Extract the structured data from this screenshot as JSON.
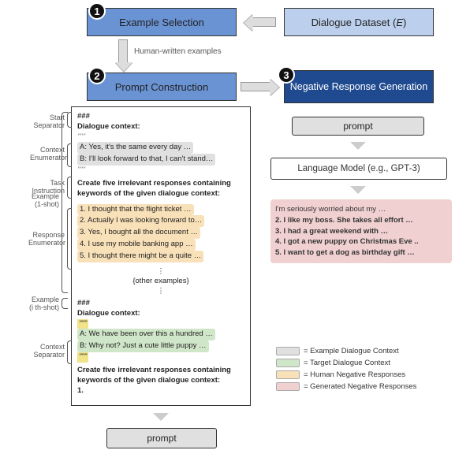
{
  "top": {
    "example_sel": "Example Selection",
    "dataset": "Dialogue Dataset (E)",
    "prompt_con": "Prompt Construction",
    "neg_gen": "Negative Response Generation",
    "hw_examples": "Human-written examples"
  },
  "numbers": {
    "n1": "1",
    "n2": "2",
    "n3": "3"
  },
  "labels": {
    "start_sep": "Start\nSeparator",
    "ctx_enum": "Context\nEnumerator",
    "task_inst": "Task\nInstruction",
    "resp_enum": "Response\nEnumerator",
    "ex_1shot": "Example\n(1-shot)",
    "ex_ishot": "Example\n(i th-shot)",
    "ctx_sep": "Context\nSeparator"
  },
  "prompt": {
    "sep1": "###",
    "dc_header": "Dialogue context:",
    "quote": "\"\"\"",
    "ctx_a": "A:  Yes, it's the same every day …",
    "ctx_b": "B:  I'll look forward to that, I can't stand…",
    "task": "Create five irrelevant responses containing keywords of the given dialogue context:",
    "r1": "1.  I thought that the flight ticket …",
    "r2": "2.  Actually I was looking forward to…",
    "r3": "3.  Yes, I bought all the document …",
    "r4": "4.  I use my mobile banking app …",
    "r5": "5.  I thought there might be a quite …",
    "other": "{other examples}",
    "vdots": "⋮",
    "sep2": "###",
    "tgt_a": "A:  We have been over this a hundred …",
    "tgt_b": "B:  Why not? Just a cute little puppy …",
    "final1": "1."
  },
  "bottom": {
    "prompt1": "prompt",
    "prompt2": "prompt",
    "lm": "Language Model (e.g., GPT-3)"
  },
  "gen": {
    "g1": "    I'm seriously worried about my …",
    "g2": "2. I like my boss. She takes all effort …",
    "g3": "3. I had a great weekend with …",
    "g4": "4. I got a new puppy on Christmas Eve ..",
    "g5": "5. I want to get a dog as birthday gift …"
  },
  "legend": {
    "l1": "= Example Dialogue Context",
    "l2": "= Target Dialogue Context",
    "l3": "= Human Negative Responses",
    "l4": "= Generated Negative Responses"
  }
}
